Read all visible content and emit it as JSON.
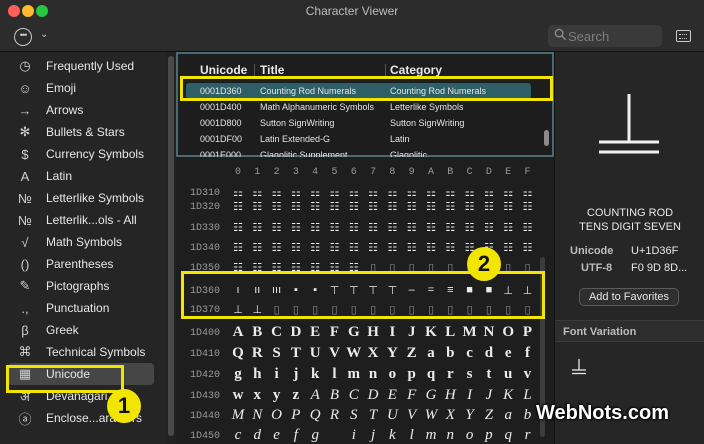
{
  "window": {
    "title": "Character Viewer"
  },
  "toolbar": {
    "search_placeholder": "Search"
  },
  "sidebar": {
    "items": [
      {
        "label": "Frequently Used",
        "icon": "clock-icon",
        "glyph": "◷"
      },
      {
        "label": "Emoji",
        "icon": "smiley-icon",
        "glyph": "☺"
      },
      {
        "label": "Arrows",
        "icon": "arrow-icon",
        "glyph": "→"
      },
      {
        "label": "Bullets & Stars",
        "icon": "asterisk-icon",
        "glyph": "✻"
      },
      {
        "label": "Currency Symbols",
        "icon": "dollar-icon",
        "glyph": "$"
      },
      {
        "label": "Latin",
        "icon": "latin-a-icon",
        "glyph": "A"
      },
      {
        "label": "Letterlike Symbols",
        "icon": "numero-icon",
        "glyph": "№"
      },
      {
        "label": "Letterlik...ols - All",
        "icon": "numero-icon",
        "glyph": "№"
      },
      {
        "label": "Math Symbols",
        "icon": "sqrt-icon",
        "glyph": "√"
      },
      {
        "label": "Parentheses",
        "icon": "parentheses-icon",
        "glyph": "()"
      },
      {
        "label": "Pictographs",
        "icon": "pencil-icon",
        "glyph": "✎"
      },
      {
        "label": "Punctuation",
        "icon": "punctuation-icon",
        "glyph": ".,"
      },
      {
        "label": "Greek",
        "icon": "beta-icon",
        "glyph": "β"
      },
      {
        "label": "Technical Symbols",
        "icon": "command-icon",
        "glyph": "⌘"
      },
      {
        "label": "Unicode",
        "icon": "grid-icon",
        "glyph": "▦",
        "selected": true
      },
      {
        "label": "Devanagari",
        "icon": "devanagari-icon",
        "glyph": "अ"
      },
      {
        "label": "Enclose...aracters",
        "icon": "circled-a-icon",
        "glyph": "ⓐ"
      }
    ]
  },
  "table": {
    "headers": {
      "unicode": "Unicode",
      "title": "Title",
      "category": "Category"
    },
    "rows": [
      {
        "code": "0001D360",
        "title": "Counting Rod Numerals",
        "category": "Counting Rod Numerals",
        "selected": true
      },
      {
        "code": "0001D400",
        "title": "Math Alphanumeric Symbols",
        "category": "Letterlike Symbols"
      },
      {
        "code": "0001D800",
        "title": "Sutton SignWriting",
        "category": "Sutton SignWriting"
      },
      {
        "code": "0001DF00",
        "title": "Latin Extended-G",
        "category": "Latin"
      },
      {
        "code": "0001E000",
        "title": "Glagolitic Supplement",
        "category": "Glagolitic"
      }
    ]
  },
  "grid": {
    "columns": [
      "0",
      "1",
      "2",
      "3",
      "4",
      "5",
      "6",
      "7",
      "8",
      "9",
      "A",
      "B",
      "C",
      "D",
      "E",
      "F"
    ],
    "rows": [
      {
        "label": "1D310",
        "cells": [
          "⚏",
          "⚏",
          "⚏",
          "⚏",
          "⚏",
          "⚏",
          "⚏",
          "⚏",
          "⚏",
          "⚏",
          "⚏",
          "⚏",
          "⚏",
          "⚏",
          "⚏",
          "⚏"
        ]
      },
      {
        "label": "1D320",
        "cells": [
          "☷",
          "☷",
          "☷",
          "☷",
          "☷",
          "☷",
          "☷",
          "☷",
          "☷",
          "☷",
          "☷",
          "☷",
          "☷",
          "☷",
          "☷",
          "☷"
        ]
      },
      {
        "label": "1D330",
        "cells": [
          "☷",
          "☷",
          "☷",
          "☷",
          "☷",
          "☷",
          "☷",
          "☷",
          "☷",
          "☷",
          "☷",
          "☷",
          "☷",
          "☷",
          "☷",
          "☷"
        ]
      },
      {
        "label": "1D340",
        "cells": [
          "☷",
          "☷",
          "☷",
          "☷",
          "☷",
          "☷",
          "☷",
          "☷",
          "☷",
          "☷",
          "☷",
          "☷",
          "☷",
          "☷",
          "☷",
          "☷"
        ]
      },
      {
        "label": "1D350",
        "cells": [
          "☷",
          "☷",
          "☷",
          "☷",
          "☷",
          "☷",
          "☷",
          "▯",
          "▯",
          "▯",
          "▯",
          "▯",
          "▯",
          "▯",
          "▯",
          "▯"
        ]
      },
      {
        "label": "1D360",
        "cells": [
          "ı",
          "ıı",
          "ııı",
          "▪",
          "▪",
          "⊤",
          "⊤",
          "⊤",
          "⊤",
          "–",
          "=",
          "≡",
          "■",
          "■",
          "⊥",
          "⊥"
        ]
      },
      {
        "label": "1D370",
        "cells": [
          "⊥",
          "⊥",
          "▯",
          "▯",
          "▯",
          "▯",
          "▯",
          "▯",
          "▯",
          "▯",
          "▯",
          "▯",
          "▯",
          "▯",
          "▯",
          "▯"
        ]
      },
      {
        "label": "1D400",
        "cells": [
          "A",
          "B",
          "C",
          "D",
          "E",
          "F",
          "G",
          "H",
          "I",
          "J",
          "K",
          "L",
          "M",
          "N",
          "O",
          "P"
        ]
      },
      {
        "label": "1D410",
        "cells": [
          "Q",
          "R",
          "S",
          "T",
          "U",
          "V",
          "W",
          "X",
          "Y",
          "Z",
          "a",
          "b",
          "c",
          "d",
          "e",
          "f"
        ]
      },
      {
        "label": "1D420",
        "cells": [
          "g",
          "h",
          "i",
          "j",
          "k",
          "l",
          "m",
          "n",
          "o",
          "p",
          "q",
          "r",
          "s",
          "t",
          "u",
          "v"
        ]
      },
      {
        "label": "1D430",
        "cells": [
          "w",
          "x",
          "y",
          "z",
          "A",
          "B",
          "C",
          "D",
          "E",
          "F",
          "G",
          "H",
          "I",
          "J",
          "K",
          "L"
        ]
      },
      {
        "label": "1D440",
        "cells": [
          "M",
          "N",
          "O",
          "P",
          "Q",
          "R",
          "S",
          "T",
          "U",
          "V",
          "W",
          "X",
          "Y",
          "Z",
          "a",
          "b"
        ]
      },
      {
        "label": "1D450",
        "cells": [
          "c",
          "d",
          "e",
          "f",
          "g",
          "",
          "i",
          "j",
          "k",
          "l",
          "m",
          "n",
          "o",
          "p",
          "q",
          "r"
        ]
      }
    ]
  },
  "detail": {
    "name_line1": "COUNTING ROD",
    "name_line2": "TENS DIGIT SEVEN",
    "unicode_label": "Unicode",
    "unicode_value": "U+1D36F",
    "utf8_label": "UTF-8",
    "utf8_value": "F0 9D 8D...",
    "favorites_button": "Add to Favorites",
    "font_variation_label": "Font Variation"
  },
  "annotations": {
    "badge1": "1",
    "badge2": "2",
    "watermark": "WebNots.com"
  },
  "colors": {
    "highlight": "#f2e600",
    "selection": "#2e5f66",
    "sidebar_selected": "#464646"
  }
}
